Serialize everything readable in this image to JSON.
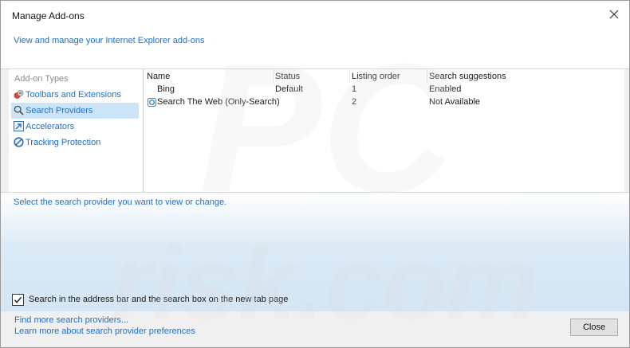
{
  "window": {
    "title": "Manage Add-ons"
  },
  "header": {
    "link": "View and manage your Internet Explorer add-ons"
  },
  "sidebar": {
    "heading": "Add-on Types",
    "items": [
      {
        "label": "Toolbars and Extensions",
        "icon": "toolbars-extensions-icon",
        "selected": false
      },
      {
        "label": "Search Providers",
        "icon": "search-providers-icon",
        "selected": true
      },
      {
        "label": "Accelerators",
        "icon": "accelerators-icon",
        "selected": false
      },
      {
        "label": "Tracking Protection",
        "icon": "tracking-protection-icon",
        "selected": false
      }
    ]
  },
  "list": {
    "columns": [
      "Name",
      "Status",
      "Listing order",
      "Search suggestions"
    ],
    "rows": [
      {
        "name": "Bing",
        "status": "Default",
        "order": "1",
        "suggestions": "Enabled",
        "icon": ""
      },
      {
        "name": "Search The Web (Only-Search)",
        "status": "",
        "order": "2",
        "suggestions": "Not Available",
        "icon": "search-provider-icon"
      }
    ]
  },
  "details": {
    "prompt": "Select the search provider you want to view or change.",
    "checkbox_label": "Search in the address bar and the search box on the new tab page",
    "checkbox_checked": true
  },
  "footer": {
    "link_find": "Find more search providers...",
    "link_learn": "Learn more about search provider preferences",
    "close_label": "Close"
  },
  "colors": {
    "link": "#1e6fc7",
    "selection": "#cce4f7"
  }
}
